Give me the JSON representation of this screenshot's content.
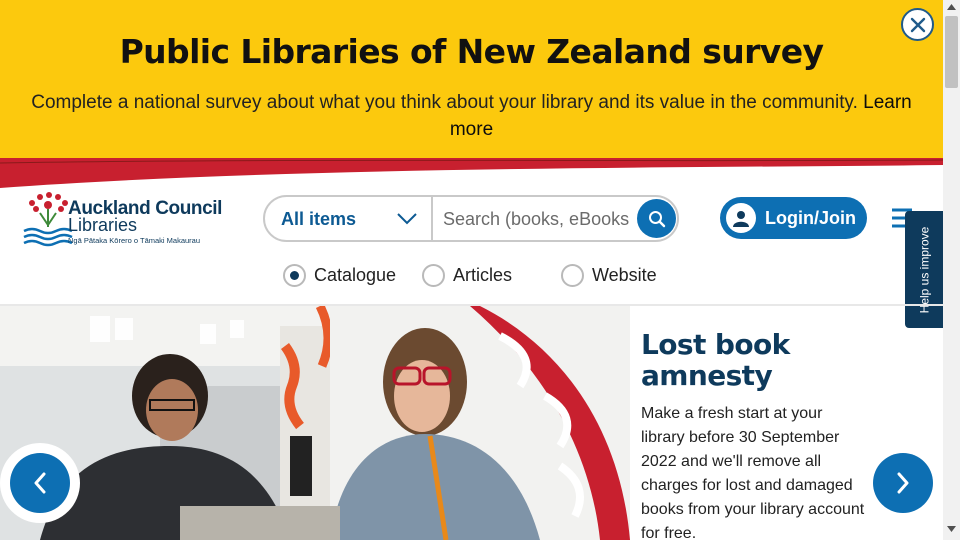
{
  "banner": {
    "title": "Public Libraries of New Zealand survey",
    "text": "Complete a national survey about what you think about your library and its value in the community.",
    "link": "Learn more",
    "close_icon": "close-icon"
  },
  "logo": {
    "name": "Auckland Council",
    "sub": "Libraries",
    "tagline": "Ngā Pātaka Kōrero o Tāmaki Makaurau"
  },
  "search": {
    "category": "All items",
    "placeholder": "Search (books, eBooks",
    "button_icon": "search-icon"
  },
  "scope": {
    "options": [
      "Catalogue",
      "Articles",
      "Website"
    ],
    "selected": "Catalogue"
  },
  "header": {
    "login_label": "Login/Join",
    "help_tab": "Help us improve"
  },
  "hero": {
    "title": "Lost book amnesty",
    "text": "Make a fresh start at your library before 30 September 2022 and we'll remove all charges for lost and damaged books from your library account for free."
  },
  "colors": {
    "banner": "#fcc90d",
    "brand_blue": "#0d6fb3",
    "navy": "#0e3a5c",
    "accent_red": "#c8202f"
  }
}
